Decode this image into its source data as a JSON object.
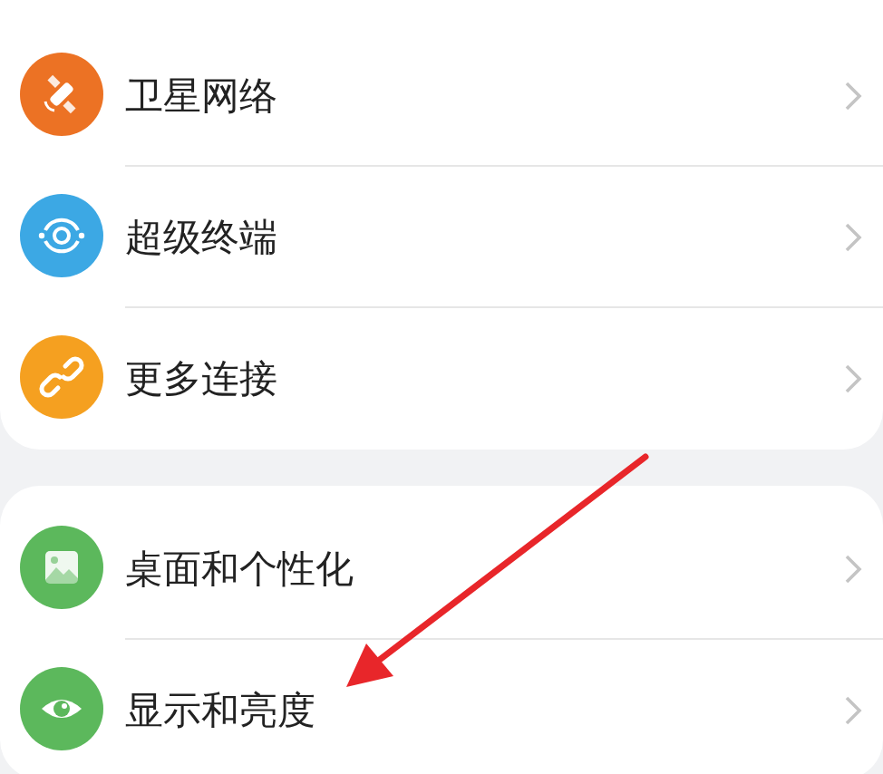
{
  "groups": [
    {
      "items": [
        {
          "label": "卫星网络",
          "color": "#ec7224"
        },
        {
          "label": "超级终端",
          "color": "#3ca8e4"
        },
        {
          "label": "更多连接",
          "color": "#f5a020"
        }
      ]
    },
    {
      "items": [
        {
          "label": "桌面和个性化",
          "color": "#5cb85c"
        },
        {
          "label": "显示和亮度",
          "color": "#5cb85c"
        }
      ]
    }
  ]
}
